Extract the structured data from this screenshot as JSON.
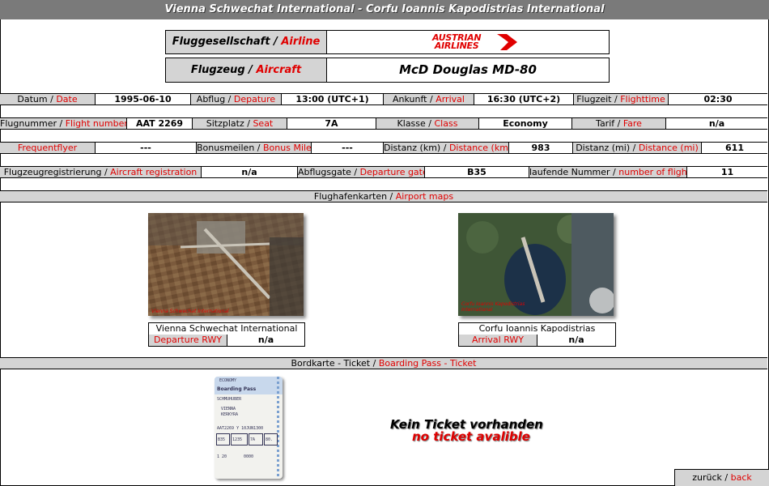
{
  "title": "Vienna Schwechat International - Corfu Ioannis Kapodistrias International",
  "airline": {
    "label_de": "Fluggesellschaft",
    "sep": " / ",
    "label_en": "Airline",
    "logo_line1": "AUSTRIAN",
    "logo_line2": "AIRLINES"
  },
  "aircraft": {
    "label_de": "Flugzeug",
    "sep": " / ",
    "label_en": "Aircraft",
    "value": "McD Douglas MD-80"
  },
  "row1": {
    "date_de": "Datum",
    "date_en": "Date",
    "date": "1995-06-10",
    "dep_de": "Abflug",
    "dep_en": "Depature",
    "dep": "13:00 (UTC+1)",
    "arr_de": "Ankunft",
    "arr_en": "Arrival",
    "arr": "16:30 (UTC+2)",
    "ft_de": "Flugzeit",
    "ft_en": "Flighttime",
    "ft": "02:30"
  },
  "row2": {
    "fn_de": "Flugnummer",
    "fn_en": "Flight number",
    "fn": "AAT 2269",
    "seat_de": "Sitzplatz",
    "seat_en": "Seat",
    "seat": "7A",
    "class_de": "Klasse",
    "class_en": "Class",
    "class": "Economy",
    "fare_de": "Tarif",
    "fare_en": "Fare",
    "fare": "n/a"
  },
  "row3": {
    "ff_en": "Frequentflyer",
    "ff": "---",
    "bm_de": "Bonusmeilen",
    "bm_en": "Bonus Miles",
    "bm": "---",
    "dkm_de": "Distanz (km)",
    "dkm_en": "Distance (km)",
    "dkm": "983",
    "dmi_de": "Distanz (mi)",
    "dmi_en": "Distance (mi)",
    "dmi": "611"
  },
  "row4": {
    "reg_de": "Flugzeugregistrierung",
    "reg_en": "Aircraft registration",
    "reg": "n/a",
    "gate_de": "Abflugsgate",
    "gate_en": "Departure gate",
    "gate": "B35",
    "num_de": "laufende Nummer",
    "num_en": "number of flights",
    "num": "11"
  },
  "maps_section": {
    "de": "Flughafenkarten",
    "en": "Airport maps"
  },
  "dep_airport": {
    "name": "Vienna Schwechat International",
    "rwy_label": "Departure RWY",
    "rwy": "n/a",
    "map_caption": "Vienna Schwechat International"
  },
  "arr_airport": {
    "name": "Corfu Ioannis Kapodistrias Internat.",
    "rwy_label": "Arrival RWY",
    "rwy": "n/a",
    "map_caption": "Corfu Ioannis Kapodistrias International"
  },
  "ticket_section": {
    "de": "Bordkarte - Ticket",
    "en": "Boarding Pass - Ticket"
  },
  "boarding_pass": {
    "class": "ECONOMY",
    "title": "Boarding Pass",
    "name": "SCHMUHUBER",
    "from": "VIENNA",
    "to": "KERKYRA",
    "flight": "AAT2269 Y 10JUN1300",
    "gate": "B35",
    "time": "1235",
    "seat": "7A",
    "board": "80.",
    "seq": "1  20",
    "code": "0000"
  },
  "no_ticket": {
    "de": "Kein Ticket vorhanden",
    "en": "no ticket avalible"
  },
  "back": {
    "de": "zurück",
    "en": "back"
  }
}
